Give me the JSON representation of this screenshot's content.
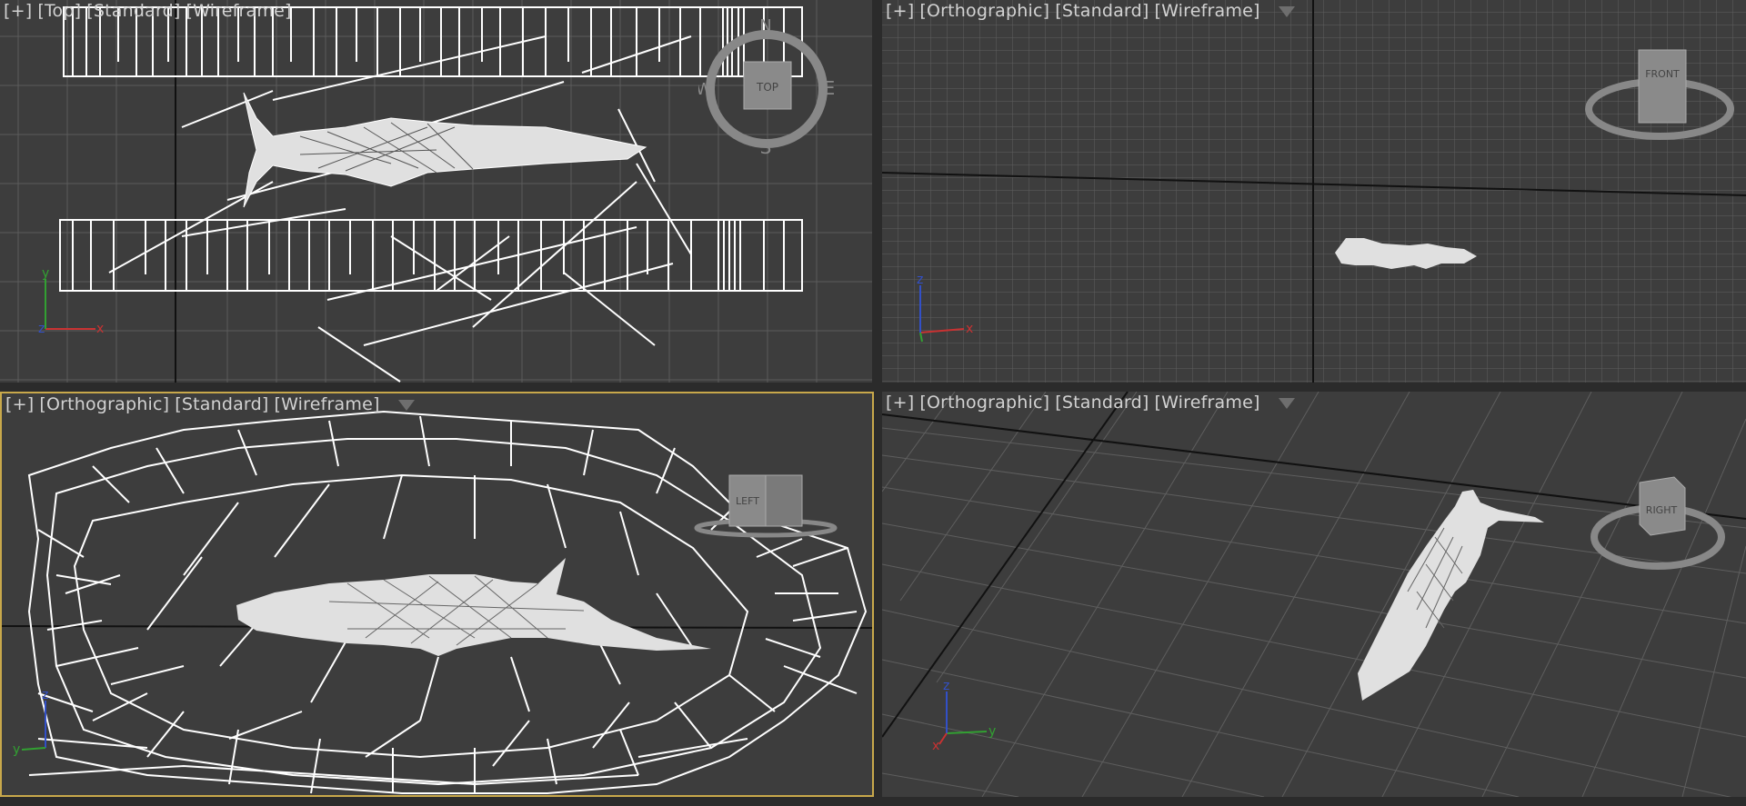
{
  "viewports": {
    "top": {
      "plus": "[+]",
      "view": "[Top]",
      "shading": "[Standard]",
      "mode": "[Wireframe]",
      "cube_face": "TOP",
      "compass": {
        "n": "N",
        "e": "E",
        "s": "S",
        "w": "W"
      }
    },
    "front": {
      "plus": "[+]",
      "view": "[Orthographic]",
      "shading": "[Standard]",
      "mode": "[Wireframe]",
      "cube_face": "FRONT"
    },
    "left": {
      "plus": "[+]",
      "view": "[Orthographic]",
      "shading": "[Standard]",
      "mode": "[Wireframe]",
      "cube_face": "LEFT"
    },
    "persp": {
      "plus": "[+]",
      "view": "[Orthographic]",
      "shading": "[Standard]",
      "mode": "[Wireframe]",
      "cube_face": "RIGHT"
    }
  },
  "axes": {
    "x": "x",
    "y": "y",
    "z": "z"
  },
  "colors": {
    "viewport_bg": "#3d3d3d",
    "grid": "#5c5c5c",
    "active_border": "#c8a84b",
    "wire": "#ffffff",
    "axis_x": "#c83232",
    "axis_y": "#32a032",
    "axis_z": "#3250c8"
  },
  "active_viewport": "left"
}
